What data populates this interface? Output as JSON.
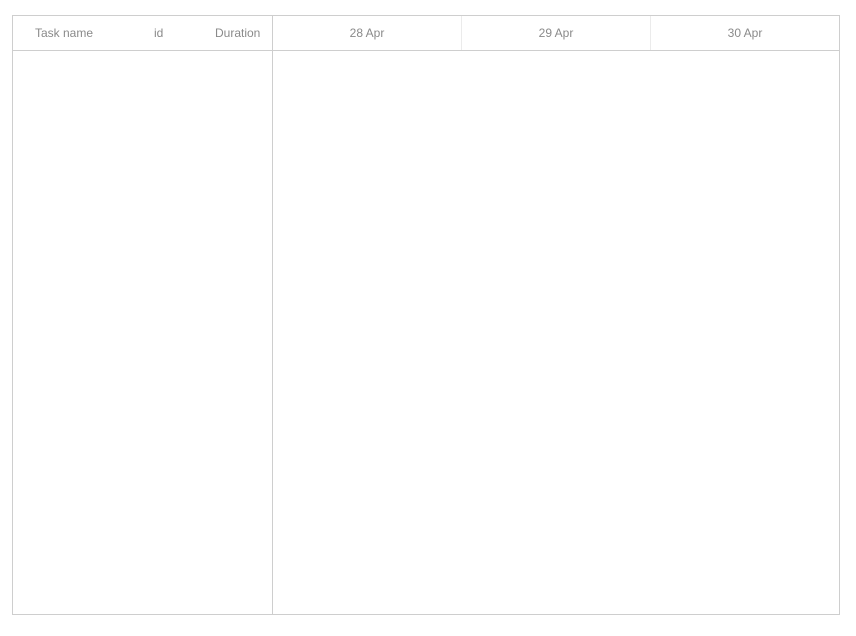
{
  "grid": {
    "columns": [
      {
        "key": "text",
        "label": "Task name"
      },
      {
        "key": "id",
        "label": "id"
      },
      {
        "key": "duration",
        "label": "Duration"
      }
    ],
    "rows": []
  },
  "timeline": {
    "scale": [
      "28 Apr",
      "29 Apr",
      "30 Apr"
    ],
    "tasks": []
  },
  "colors": {
    "border": "#cecece",
    "scale_divider": "#ebebeb",
    "header_text": "#8a8a8a",
    "background": "#ffffff"
  }
}
